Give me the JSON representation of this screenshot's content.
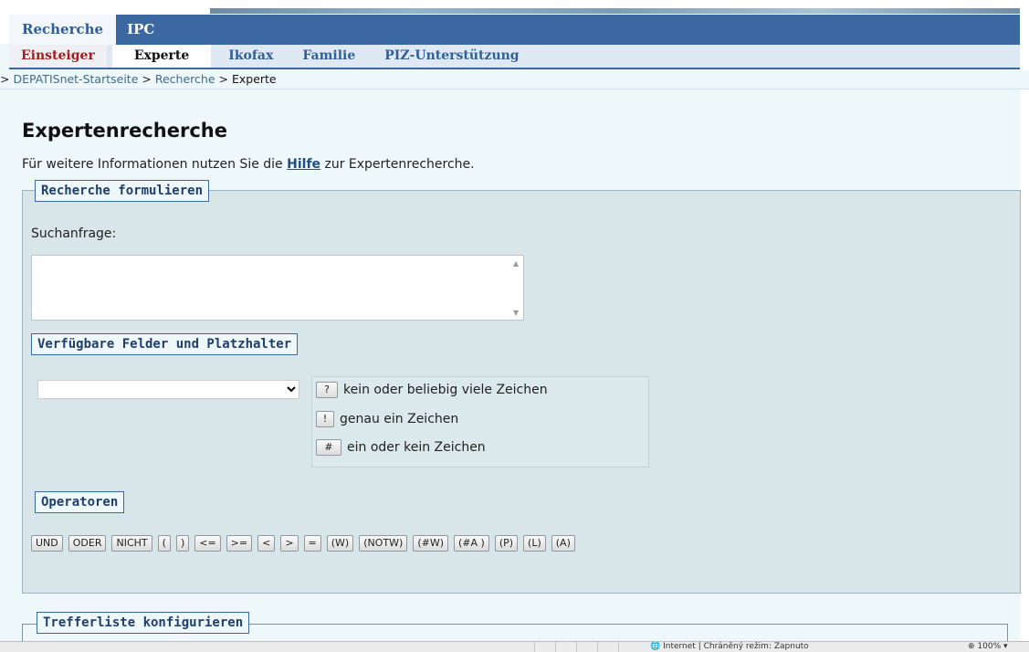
{
  "nav": {
    "main_tabs": [
      "Recherche",
      "IPC"
    ],
    "sub_tabs": [
      "Einsteiger",
      "Experte",
      "Ikofax",
      "Familie",
      "PIZ-Unterstützung"
    ]
  },
  "breadcrumb": {
    "prefix": ">",
    "home": "DEPATISnet-Startseite",
    "sep": ">",
    "section": "Recherche",
    "current": "Experte"
  },
  "page": {
    "title": "Expertenrecherche",
    "intro_before": "Für weitere Informationen nutzen Sie die ",
    "intro_link": "Hilfe",
    "intro_after": " zur Expertenrecherche."
  },
  "form": {
    "legend": "Recherche formulieren",
    "query_label": "Suchanfrage:",
    "query_value": "",
    "fields_legend": "Verfügbare Felder und Platzhalter",
    "fields_selected": "",
    "placeholders": [
      {
        "symbol": "?",
        "text": "kein oder beliebig viele Zeichen"
      },
      {
        "symbol": "!",
        "text": "genau ein Zeichen"
      },
      {
        "symbol": "#",
        "text": "ein oder kein Zeichen"
      }
    ],
    "operators_legend": "Operatoren",
    "operators": [
      "UND",
      "ODER",
      "NICHT",
      "(",
      ")",
      "<=",
      ">=",
      "<",
      ">",
      "=",
      "(W)",
      "(NOTW)",
      "(#W)",
      "(#A )",
      "(P)",
      "(L)",
      "(A)"
    ]
  },
  "results": {
    "legend": "Trefferliste konfigurieren"
  },
  "statusbar": {
    "zone": "Internet | Chráněný režim: Zapnuto",
    "zoom": "100%"
  }
}
